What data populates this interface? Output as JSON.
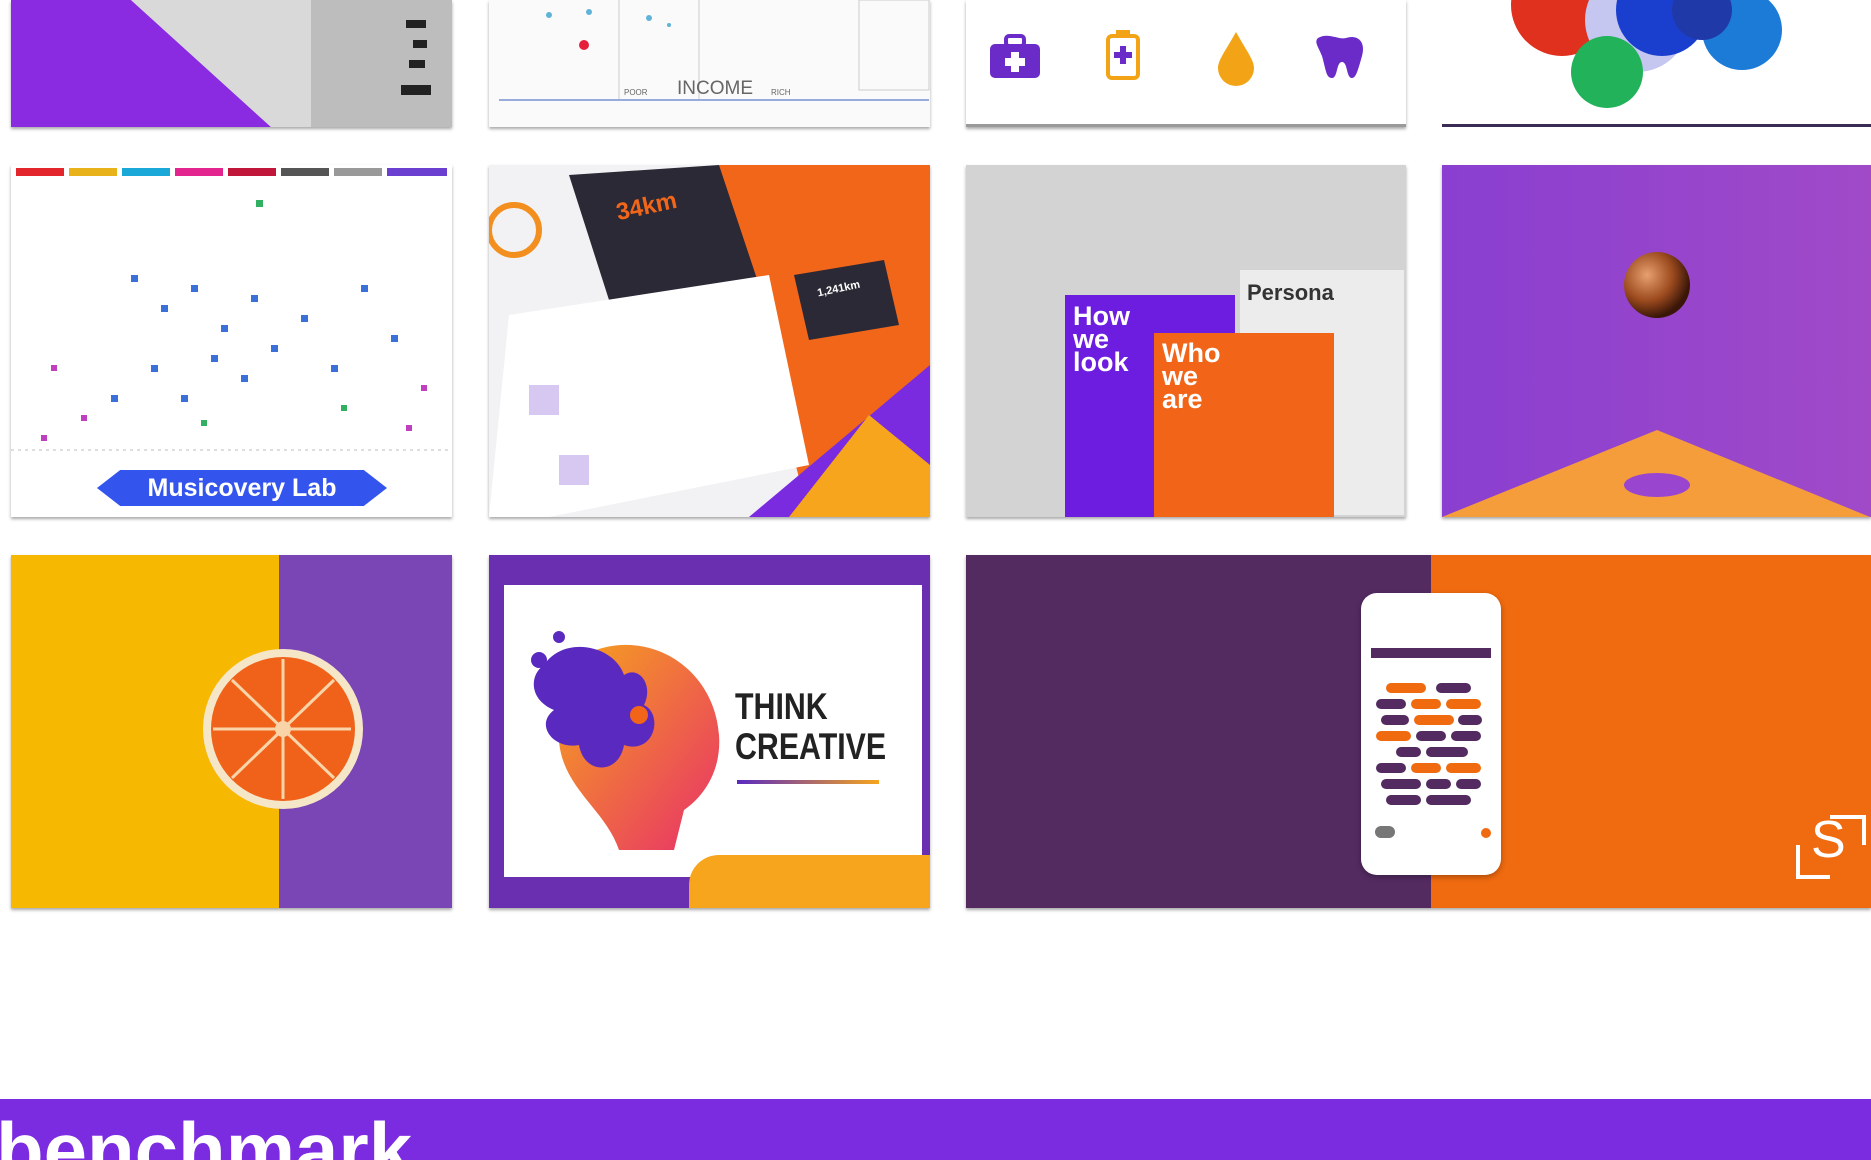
{
  "thumbnails": {
    "data_viz": {
      "axis_label": "INCOME",
      "axis_left": "POOR",
      "axis_right": "RICH"
    },
    "musicovery": {
      "label": "Musicovery Lab"
    },
    "fitness_app": {
      "distance": "34km",
      "stat": "1,241km"
    },
    "persona": {
      "card1": [
        "How",
        "we",
        "look"
      ],
      "card2": [
        "Who",
        "we",
        "are"
      ],
      "card3": "Persona"
    },
    "think_creative": {
      "line1": "THINK",
      "line2": "CREATIVE"
    },
    "app_mock": {
      "logo_letter": "S"
    }
  },
  "colors": {
    "purple": "#7b2be0",
    "orange": "#f06a0f",
    "deep_purple": "#532b61",
    "yellow": "#f6b800"
  },
  "footer": {
    "title": "benchmark"
  }
}
